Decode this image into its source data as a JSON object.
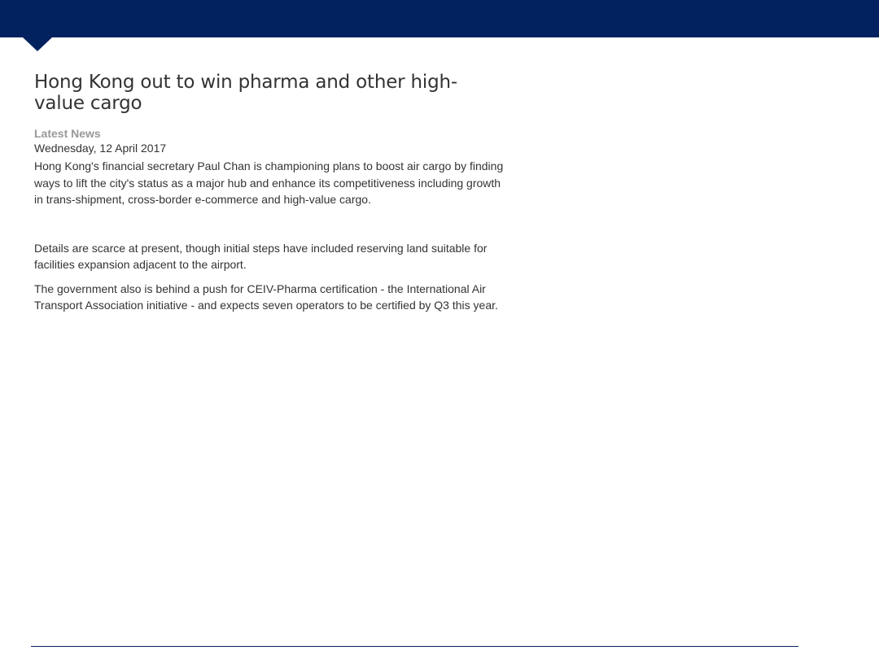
{
  "article": {
    "headline": "Hong Kong out to win pharma and other high-value cargo",
    "category": "Latest News",
    "date": "Wednesday, 12 April 2017",
    "paragraphs": [
      "Hong Kong's financial secretary Paul Chan is championing plans to boost air cargo by finding ways to lift the city's status as a major hub and enhance its competitiveness including growth in trans-shipment, cross-border e-commerce and high-value cargo.",
      "Details are scarce at present, though initial steps have included reserving land suitable for facilities expansion adjacent to the airport.",
      "The government also is behind a push for CEIV-Pharma certification - the International Air Transport Association initiative - and expects seven operators to be certified by Q3 this year."
    ]
  },
  "colors": {
    "banner": "#02215f",
    "text": "#333333",
    "category": "#999999"
  }
}
